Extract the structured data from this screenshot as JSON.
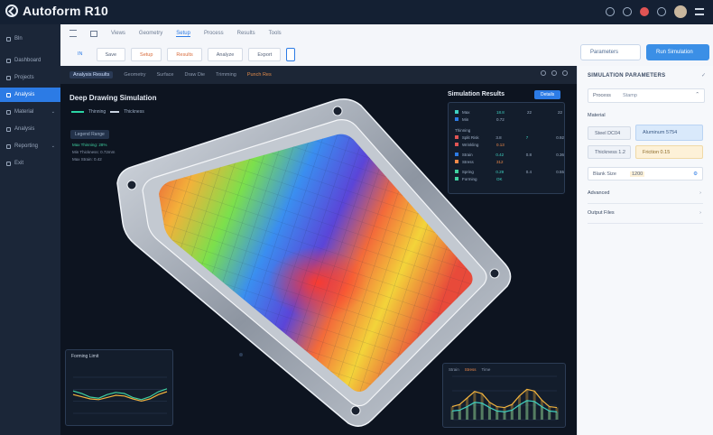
{
  "app": {
    "name": "Autoform R10"
  },
  "topbar": {
    "icons": [
      "settings-icon",
      "bell-icon",
      "alert-icon",
      "user-avatar",
      "menu-icon"
    ]
  },
  "sidebar": {
    "items": [
      {
        "label": "Bln"
      },
      {
        "label": "Dashboard"
      },
      {
        "label": "Projects"
      },
      {
        "label": "Analysis"
      },
      {
        "label": "Material"
      },
      {
        "label": "Analysis"
      },
      {
        "label": "Reporting"
      },
      {
        "label": "Exit"
      }
    ],
    "active_index": 3
  },
  "toolbar": {
    "tabs": [
      "Views",
      "Geometry",
      "Setup",
      "Process",
      "Results",
      "Tools"
    ],
    "active_tab_index": 2,
    "tools": [
      "IN",
      "Save",
      "Setup",
      "Results",
      "Analyze",
      "Export"
    ],
    "highlight_tools": [
      2,
      3
    ],
    "secondary_button": "Parameters",
    "primary_button": "Run Simulation"
  },
  "viewport": {
    "menu": [
      "Analysis Results",
      "Geometry",
      "Surface",
      "Draw Die",
      "Trimming",
      "Punch Res"
    ],
    "title": "Deep Drawing Simulation",
    "sub_labels": [
      "Thinning",
      "Thickness"
    ],
    "chip": "Legend Range",
    "legend": [
      "Max Thinning: 28%",
      "Min Thickness: 0.72mm",
      "Max Strain: 0.42"
    ]
  },
  "results_panel": {
    "title": "Simulation Results",
    "button": "Details",
    "rows": [
      {
        "label": "Max",
        "v1": "18.8",
        "v2": "22",
        "v3": "22",
        "color": "#3fd0c0"
      },
      {
        "label": "Min",
        "v1": "0.72",
        "v2": "",
        "v3": "",
        "color": "#2c7be5"
      },
      {
        "label": "Thinning",
        "v1": "",
        "v2": "",
        "v3": "",
        "color": "#9fb0c7"
      },
      {
        "label": "Split Risk",
        "v1": "3.8",
        "v2": "7",
        "v3": "0.92",
        "color": "#e05454"
      },
      {
        "label": "Wrinkling",
        "v1": "0.13",
        "v2": "",
        "v3": "",
        "color": "#e05454"
      },
      {
        "label": "Strain",
        "v1": "0.42",
        "v2": "0.8",
        "v3": "0.36",
        "color": "#2c7be5"
      },
      {
        "label": "Stress",
        "v1": "312",
        "v2": "",
        "v3": "",
        "color": "#f08a4a"
      },
      {
        "label": "Spring",
        "v1": "0.29",
        "v2": "0.4",
        "v3": "0.55",
        "color": "#3fd0a0"
      },
      {
        "label": "Forming",
        "v1": "OK",
        "v2": "",
        "v3": "",
        "color": "#3fd0a0"
      }
    ]
  },
  "mini_chart_left": {
    "title": "Forming Limit",
    "chart_data": {
      "type": "line",
      "series": [
        {
          "values": [
            0.62,
            0.55,
            0.45,
            0.42,
            0.52,
            0.58,
            0.55,
            0.44,
            0.38,
            0.46,
            0.6,
            0.68
          ],
          "color": "#3fd0a0"
        },
        {
          "values": [
            0.52,
            0.46,
            0.4,
            0.38,
            0.44,
            0.5,
            0.48,
            0.4,
            0.34,
            0.4,
            0.52,
            0.6
          ],
          "color": "#f2b33d"
        }
      ],
      "ylim": [
        0,
        1
      ]
    }
  },
  "mini_chart_right": {
    "header": [
      "Strain",
      "Stress",
      "Time"
    ],
    "chart_data": {
      "type": "area",
      "series": [
        {
          "values": [
            0.3,
            0.35,
            0.5,
            0.65,
            0.6,
            0.4,
            0.3,
            0.28,
            0.35,
            0.55,
            0.7,
            0.66,
            0.45,
            0.3,
            0.28
          ],
          "color": "#f2b33d"
        },
        {
          "values": [
            0.2,
            0.22,
            0.3,
            0.4,
            0.38,
            0.28,
            0.2,
            0.18,
            0.22,
            0.34,
            0.44,
            0.42,
            0.3,
            0.2,
            0.18
          ],
          "color": "#3fd0c0"
        }
      ],
      "ylim": [
        0,
        1
      ]
    }
  },
  "right_panel": {
    "header": "SIMULATION PARAMETERS",
    "select_label": "Process",
    "select_value": "Stamp",
    "section": "Material",
    "buttons": [
      "Steel DC04",
      "Aluminum 5754",
      "Thickness 1.2",
      "Friction 0.15"
    ],
    "field_label": "Blank Size",
    "field_value": "1200",
    "rows": [
      "Advanced",
      "Output Files"
    ]
  },
  "colors": {
    "accent": "#2c7be5",
    "sidebar_bg": "#1b2638",
    "topbar_bg": "#142033",
    "viewport_bg": "#0d1420"
  }
}
